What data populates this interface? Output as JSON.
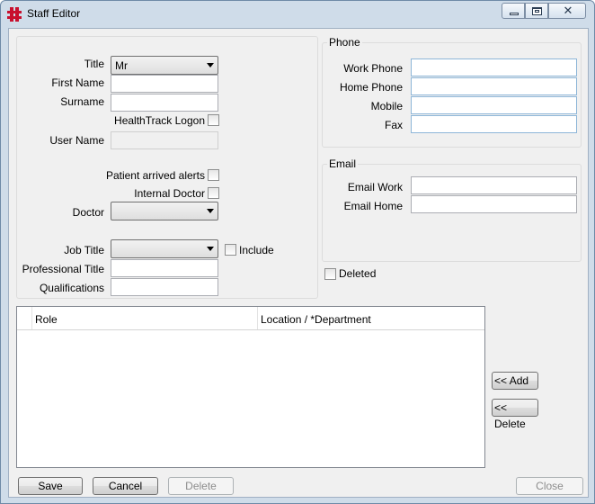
{
  "window": {
    "title": "Staff Editor"
  },
  "personal": {
    "title_label": "Title",
    "title_value": "Mr",
    "first_name_label": "First Name",
    "first_name_value": "",
    "surname_label": "Surname",
    "surname_value": "",
    "healthtrack_logon_label": "HealthTrack Logon",
    "user_name_label": "User Name",
    "user_name_value": "",
    "patient_alerts_label": "Patient arrived alerts",
    "internal_doctor_label": "Internal Doctor",
    "doctor_label": "Doctor",
    "doctor_value": "",
    "job_title_label": "Job Title",
    "job_title_value": "",
    "include_label": "Include",
    "professional_title_label": "Professional Title",
    "professional_title_value": "",
    "qualifications_label": "Qualifications",
    "qualifications_value": ""
  },
  "phone": {
    "caption": "Phone",
    "work_label": "Work Phone",
    "home_label": "Home Phone",
    "mobile_label": "Mobile",
    "fax_label": "Fax",
    "work_value": "",
    "home_value": "",
    "mobile_value": "",
    "fax_value": ""
  },
  "email": {
    "caption": "Email",
    "work_label": "Email Work",
    "home_label": "Email Home",
    "work_value": "",
    "home_value": ""
  },
  "deleted_label": "Deleted",
  "roles_grid": {
    "columns": [
      "Role",
      "Location / *Department"
    ],
    "rows": []
  },
  "buttons": {
    "add": "<< Add",
    "delete_role": "<< Delete",
    "save": "Save",
    "cancel": "Cancel",
    "delete": "Delete",
    "close": "Close"
  },
  "colors": {
    "titlebar": "#cfdce9",
    "client": "#f0f0f0",
    "logo_red": "#c8102e"
  }
}
